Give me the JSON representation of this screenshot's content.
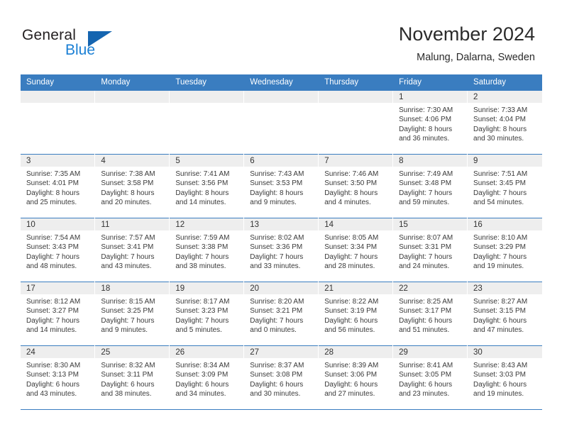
{
  "logo": {
    "word1": "General",
    "word2": "Blue",
    "triangle_color": "#1565b0",
    "blue_color": "#1a7fd4"
  },
  "header": {
    "title": "November 2024",
    "subtitle": "Malung, Dalarna, Sweden"
  },
  "theme": {
    "header_row_bg": "#3a7dc0",
    "daynum_band_bg": "#eeeeee",
    "row_divider": "#3a7dc0"
  },
  "weekdays": [
    "Sunday",
    "Monday",
    "Tuesday",
    "Wednesday",
    "Thursday",
    "Friday",
    "Saturday"
  ],
  "weeks": [
    [
      {
        "day": "",
        "sunrise": "",
        "sunset": "",
        "daylight1": "",
        "daylight2": "",
        "empty": true
      },
      {
        "day": "",
        "sunrise": "",
        "sunset": "",
        "daylight1": "",
        "daylight2": "",
        "empty": true
      },
      {
        "day": "",
        "sunrise": "",
        "sunset": "",
        "daylight1": "",
        "daylight2": "",
        "empty": true
      },
      {
        "day": "",
        "sunrise": "",
        "sunset": "",
        "daylight1": "",
        "daylight2": "",
        "empty": true
      },
      {
        "day": "",
        "sunrise": "",
        "sunset": "",
        "daylight1": "",
        "daylight2": "",
        "empty": true
      },
      {
        "day": "1",
        "sunrise": "Sunrise: 7:30 AM",
        "sunset": "Sunset: 4:06 PM",
        "daylight1": "Daylight: 8 hours",
        "daylight2": "and 36 minutes.",
        "empty": false
      },
      {
        "day": "2",
        "sunrise": "Sunrise: 7:33 AM",
        "sunset": "Sunset: 4:04 PM",
        "daylight1": "Daylight: 8 hours",
        "daylight2": "and 30 minutes.",
        "empty": false
      }
    ],
    [
      {
        "day": "3",
        "sunrise": "Sunrise: 7:35 AM",
        "sunset": "Sunset: 4:01 PM",
        "daylight1": "Daylight: 8 hours",
        "daylight2": "and 25 minutes.",
        "empty": false
      },
      {
        "day": "4",
        "sunrise": "Sunrise: 7:38 AM",
        "sunset": "Sunset: 3:58 PM",
        "daylight1": "Daylight: 8 hours",
        "daylight2": "and 20 minutes.",
        "empty": false
      },
      {
        "day": "5",
        "sunrise": "Sunrise: 7:41 AM",
        "sunset": "Sunset: 3:56 PM",
        "daylight1": "Daylight: 8 hours",
        "daylight2": "and 14 minutes.",
        "empty": false
      },
      {
        "day": "6",
        "sunrise": "Sunrise: 7:43 AM",
        "sunset": "Sunset: 3:53 PM",
        "daylight1": "Daylight: 8 hours",
        "daylight2": "and 9 minutes.",
        "empty": false
      },
      {
        "day": "7",
        "sunrise": "Sunrise: 7:46 AM",
        "sunset": "Sunset: 3:50 PM",
        "daylight1": "Daylight: 8 hours",
        "daylight2": "and 4 minutes.",
        "empty": false
      },
      {
        "day": "8",
        "sunrise": "Sunrise: 7:49 AM",
        "sunset": "Sunset: 3:48 PM",
        "daylight1": "Daylight: 7 hours",
        "daylight2": "and 59 minutes.",
        "empty": false
      },
      {
        "day": "9",
        "sunrise": "Sunrise: 7:51 AM",
        "sunset": "Sunset: 3:45 PM",
        "daylight1": "Daylight: 7 hours",
        "daylight2": "and 54 minutes.",
        "empty": false
      }
    ],
    [
      {
        "day": "10",
        "sunrise": "Sunrise: 7:54 AM",
        "sunset": "Sunset: 3:43 PM",
        "daylight1": "Daylight: 7 hours",
        "daylight2": "and 48 minutes.",
        "empty": false
      },
      {
        "day": "11",
        "sunrise": "Sunrise: 7:57 AM",
        "sunset": "Sunset: 3:41 PM",
        "daylight1": "Daylight: 7 hours",
        "daylight2": "and 43 minutes.",
        "empty": false
      },
      {
        "day": "12",
        "sunrise": "Sunrise: 7:59 AM",
        "sunset": "Sunset: 3:38 PM",
        "daylight1": "Daylight: 7 hours",
        "daylight2": "and 38 minutes.",
        "empty": false
      },
      {
        "day": "13",
        "sunrise": "Sunrise: 8:02 AM",
        "sunset": "Sunset: 3:36 PM",
        "daylight1": "Daylight: 7 hours",
        "daylight2": "and 33 minutes.",
        "empty": false
      },
      {
        "day": "14",
        "sunrise": "Sunrise: 8:05 AM",
        "sunset": "Sunset: 3:34 PM",
        "daylight1": "Daylight: 7 hours",
        "daylight2": "and 28 minutes.",
        "empty": false
      },
      {
        "day": "15",
        "sunrise": "Sunrise: 8:07 AM",
        "sunset": "Sunset: 3:31 PM",
        "daylight1": "Daylight: 7 hours",
        "daylight2": "and 24 minutes.",
        "empty": false
      },
      {
        "day": "16",
        "sunrise": "Sunrise: 8:10 AM",
        "sunset": "Sunset: 3:29 PM",
        "daylight1": "Daylight: 7 hours",
        "daylight2": "and 19 minutes.",
        "empty": false
      }
    ],
    [
      {
        "day": "17",
        "sunrise": "Sunrise: 8:12 AM",
        "sunset": "Sunset: 3:27 PM",
        "daylight1": "Daylight: 7 hours",
        "daylight2": "and 14 minutes.",
        "empty": false
      },
      {
        "day": "18",
        "sunrise": "Sunrise: 8:15 AM",
        "sunset": "Sunset: 3:25 PM",
        "daylight1": "Daylight: 7 hours",
        "daylight2": "and 9 minutes.",
        "empty": false
      },
      {
        "day": "19",
        "sunrise": "Sunrise: 8:17 AM",
        "sunset": "Sunset: 3:23 PM",
        "daylight1": "Daylight: 7 hours",
        "daylight2": "and 5 minutes.",
        "empty": false
      },
      {
        "day": "20",
        "sunrise": "Sunrise: 8:20 AM",
        "sunset": "Sunset: 3:21 PM",
        "daylight1": "Daylight: 7 hours",
        "daylight2": "and 0 minutes.",
        "empty": false
      },
      {
        "day": "21",
        "sunrise": "Sunrise: 8:22 AM",
        "sunset": "Sunset: 3:19 PM",
        "daylight1": "Daylight: 6 hours",
        "daylight2": "and 56 minutes.",
        "empty": false
      },
      {
        "day": "22",
        "sunrise": "Sunrise: 8:25 AM",
        "sunset": "Sunset: 3:17 PM",
        "daylight1": "Daylight: 6 hours",
        "daylight2": "and 51 minutes.",
        "empty": false
      },
      {
        "day": "23",
        "sunrise": "Sunrise: 8:27 AM",
        "sunset": "Sunset: 3:15 PM",
        "daylight1": "Daylight: 6 hours",
        "daylight2": "and 47 minutes.",
        "empty": false
      }
    ],
    [
      {
        "day": "24",
        "sunrise": "Sunrise: 8:30 AM",
        "sunset": "Sunset: 3:13 PM",
        "daylight1": "Daylight: 6 hours",
        "daylight2": "and 43 minutes.",
        "empty": false
      },
      {
        "day": "25",
        "sunrise": "Sunrise: 8:32 AM",
        "sunset": "Sunset: 3:11 PM",
        "daylight1": "Daylight: 6 hours",
        "daylight2": "and 38 minutes.",
        "empty": false
      },
      {
        "day": "26",
        "sunrise": "Sunrise: 8:34 AM",
        "sunset": "Sunset: 3:09 PM",
        "daylight1": "Daylight: 6 hours",
        "daylight2": "and 34 minutes.",
        "empty": false
      },
      {
        "day": "27",
        "sunrise": "Sunrise: 8:37 AM",
        "sunset": "Sunset: 3:08 PM",
        "daylight1": "Daylight: 6 hours",
        "daylight2": "and 30 minutes.",
        "empty": false
      },
      {
        "day": "28",
        "sunrise": "Sunrise: 8:39 AM",
        "sunset": "Sunset: 3:06 PM",
        "daylight1": "Daylight: 6 hours",
        "daylight2": "and 27 minutes.",
        "empty": false
      },
      {
        "day": "29",
        "sunrise": "Sunrise: 8:41 AM",
        "sunset": "Sunset: 3:05 PM",
        "daylight1": "Daylight: 6 hours",
        "daylight2": "and 23 minutes.",
        "empty": false
      },
      {
        "day": "30",
        "sunrise": "Sunrise: 8:43 AM",
        "sunset": "Sunset: 3:03 PM",
        "daylight1": "Daylight: 6 hours",
        "daylight2": "and 19 minutes.",
        "empty": false
      }
    ]
  ]
}
